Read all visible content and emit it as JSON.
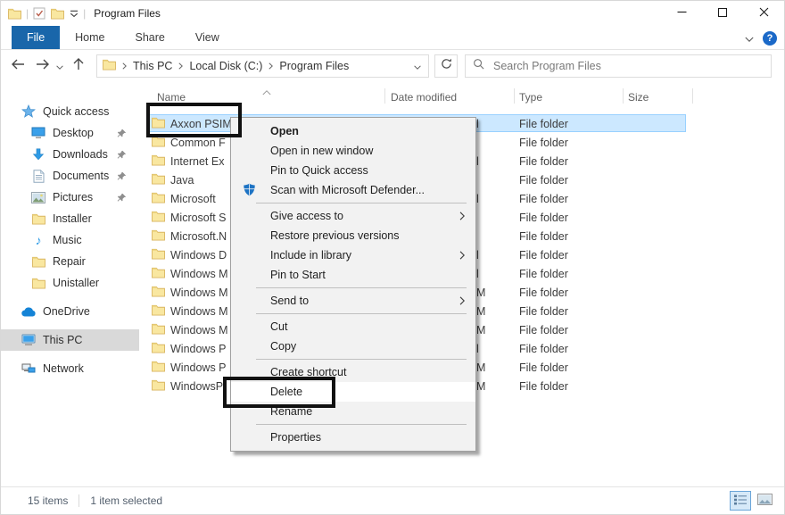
{
  "colors": {
    "accent_blue": "#1966aa",
    "selection_fill": "#cce8ff",
    "selection_border": "#99d1ff",
    "annotation": "#111111",
    "menu_bg": "#f2f2f2"
  },
  "window": {
    "title": "Program Files"
  },
  "titlebar": {
    "quick_access_icons": [
      "folder-icon",
      "check-document-icon",
      "folder-icon",
      "toolbar-chevron-icon"
    ],
    "controls": [
      "minimize",
      "maximize",
      "close"
    ]
  },
  "ribbon": {
    "tabs": [
      {
        "label": "File",
        "active": true
      },
      {
        "label": "Home",
        "active": false
      },
      {
        "label": "Share",
        "active": false
      },
      {
        "label": "View",
        "active": false
      }
    ]
  },
  "addressbar": {
    "breadcrumb": [
      "This PC",
      "Local Disk (C:)",
      "Program Files"
    ],
    "search_placeholder": "Search Program Files"
  },
  "sidebar": {
    "items": [
      {
        "label": "Quick access",
        "icon": "quick-access-star-icon"
      },
      {
        "label": "Desktop",
        "icon": "desktop-icon",
        "child": true,
        "pinned": true
      },
      {
        "label": "Downloads",
        "icon": "downloads-icon",
        "child": true,
        "pinned": true
      },
      {
        "label": "Documents",
        "icon": "documents-icon",
        "child": true,
        "pinned": true
      },
      {
        "label": "Pictures",
        "icon": "pictures-icon",
        "child": true,
        "pinned": true
      },
      {
        "label": "Installer",
        "icon": "folder-icon",
        "child": true
      },
      {
        "label": "Music",
        "icon": "music-icon",
        "child": true
      },
      {
        "label": "Repair",
        "icon": "folder-icon",
        "child": true
      },
      {
        "label": "Unistaller",
        "icon": "folder-icon",
        "child": true
      },
      {
        "label": "OneDrive",
        "icon": "onedrive-icon",
        "gap": true
      },
      {
        "label": "This PC",
        "icon": "this-pc-icon",
        "gap": true,
        "selected": true
      },
      {
        "label": "Network",
        "icon": "network-icon",
        "gap": true
      }
    ]
  },
  "filelist": {
    "columns": [
      "Name",
      "Date modified",
      "Type",
      "Size"
    ],
    "rows": [
      {
        "name": "Axxon PSIM",
        "type": "File folder",
        "selected": true,
        "date_fragment": "l"
      },
      {
        "name": "Common F",
        "type": "File folder",
        "date_fragment": ""
      },
      {
        "name": "Internet Ex",
        "type": "File folder",
        "date_fragment": "l"
      },
      {
        "name": "Java",
        "type": "File folder",
        "date_fragment": ""
      },
      {
        "name": "Microsoft",
        "type": "File folder",
        "date_fragment": "l"
      },
      {
        "name": "Microsoft S",
        "type": "File folder",
        "date_fragment": ""
      },
      {
        "name": "Microsoft.N",
        "type": "File folder",
        "date_fragment": ""
      },
      {
        "name": "Windows D",
        "type": "File folder",
        "date_fragment": "l"
      },
      {
        "name": "Windows M",
        "type": "File folder",
        "date_fragment": "l"
      },
      {
        "name": "Windows M",
        "type": "File folder",
        "date_fragment": "M"
      },
      {
        "name": "Windows M",
        "type": "File folder",
        "date_fragment": "M"
      },
      {
        "name": "Windows M",
        "type": "File folder",
        "date_fragment": "M"
      },
      {
        "name": "Windows P",
        "type": "File folder",
        "date_fragment": "l"
      },
      {
        "name": "Windows P",
        "type": "File folder",
        "date_fragment": "M"
      },
      {
        "name": "WindowsP",
        "type": "File folder",
        "date_fragment": "M"
      }
    ]
  },
  "context_menu": {
    "items": [
      {
        "label": "Open",
        "bold": true
      },
      {
        "label": "Open in new window"
      },
      {
        "label": "Pin to Quick access"
      },
      {
        "label": "Scan with Microsoft Defender...",
        "icon": "defender-shield-icon"
      },
      {
        "separator": true
      },
      {
        "label": "Give access to",
        "submenu": true
      },
      {
        "label": "Restore previous versions"
      },
      {
        "label": "Include in library",
        "submenu": true
      },
      {
        "label": "Pin to Start"
      },
      {
        "separator": true
      },
      {
        "label": "Send to",
        "submenu": true
      },
      {
        "separator": true
      },
      {
        "label": "Cut"
      },
      {
        "label": "Copy"
      },
      {
        "separator": true
      },
      {
        "label": "Create shortcut"
      },
      {
        "label": "Delete",
        "highlighted": true
      },
      {
        "label": "Rename"
      },
      {
        "separator": true
      },
      {
        "label": "Properties"
      }
    ]
  },
  "statusbar": {
    "count": "15 items",
    "selection": "1 item selected"
  }
}
